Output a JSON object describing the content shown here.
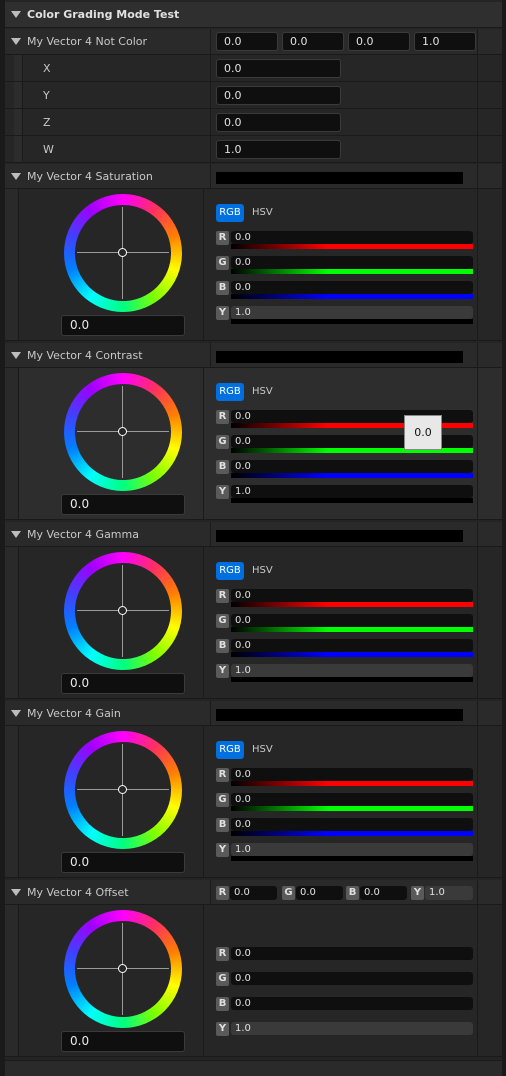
{
  "category": {
    "title": "Color Grading Mode Test"
  },
  "vector_not_color": {
    "label": "My Vector 4 Not Color",
    "values": [
      "0.0",
      "0.0",
      "0.0",
      "1.0"
    ],
    "components": [
      {
        "name": "X",
        "value": "0.0"
      },
      {
        "name": "Y",
        "value": "0.0"
      },
      {
        "name": "Z",
        "value": "0.0"
      },
      {
        "name": "W",
        "value": "1.0"
      }
    ]
  },
  "mode_labels": {
    "rgb": "RGB",
    "hsv": "HSV"
  },
  "channels": [
    "R",
    "G",
    "B",
    "Y"
  ],
  "saturation": {
    "label": "My Vector 4 Saturation",
    "wheel_value": "0.0",
    "r": "0.0",
    "g": "0.0",
    "b": "0.0",
    "y": "1.0"
  },
  "contrast": {
    "label": "My Vector 4 Contrast",
    "wheel_value": "0.0",
    "r": "0.0",
    "g": "0.0",
    "b": "0.0",
    "y": "1.0",
    "tooltip": "0.0"
  },
  "gamma": {
    "label": "My Vector 4 Gamma",
    "wheel_value": "0.0",
    "r": "0.0",
    "g": "0.0",
    "b": "0.0",
    "y": "1.0"
  },
  "gain": {
    "label": "My Vector 4 Gain",
    "wheel_value": "0.0",
    "r": "0.0",
    "g": "0.0",
    "b": "0.0",
    "y": "1.0"
  },
  "offset": {
    "label": "My Vector 4 Offset",
    "wheel_value": "0.0",
    "r": "0.0",
    "g": "0.0",
    "b": "0.0",
    "y": "1.0"
  },
  "colors": {
    "accent": "#0070e0",
    "red": "#ff0000",
    "green": "#00ff00",
    "blue": "#0000ff"
  }
}
